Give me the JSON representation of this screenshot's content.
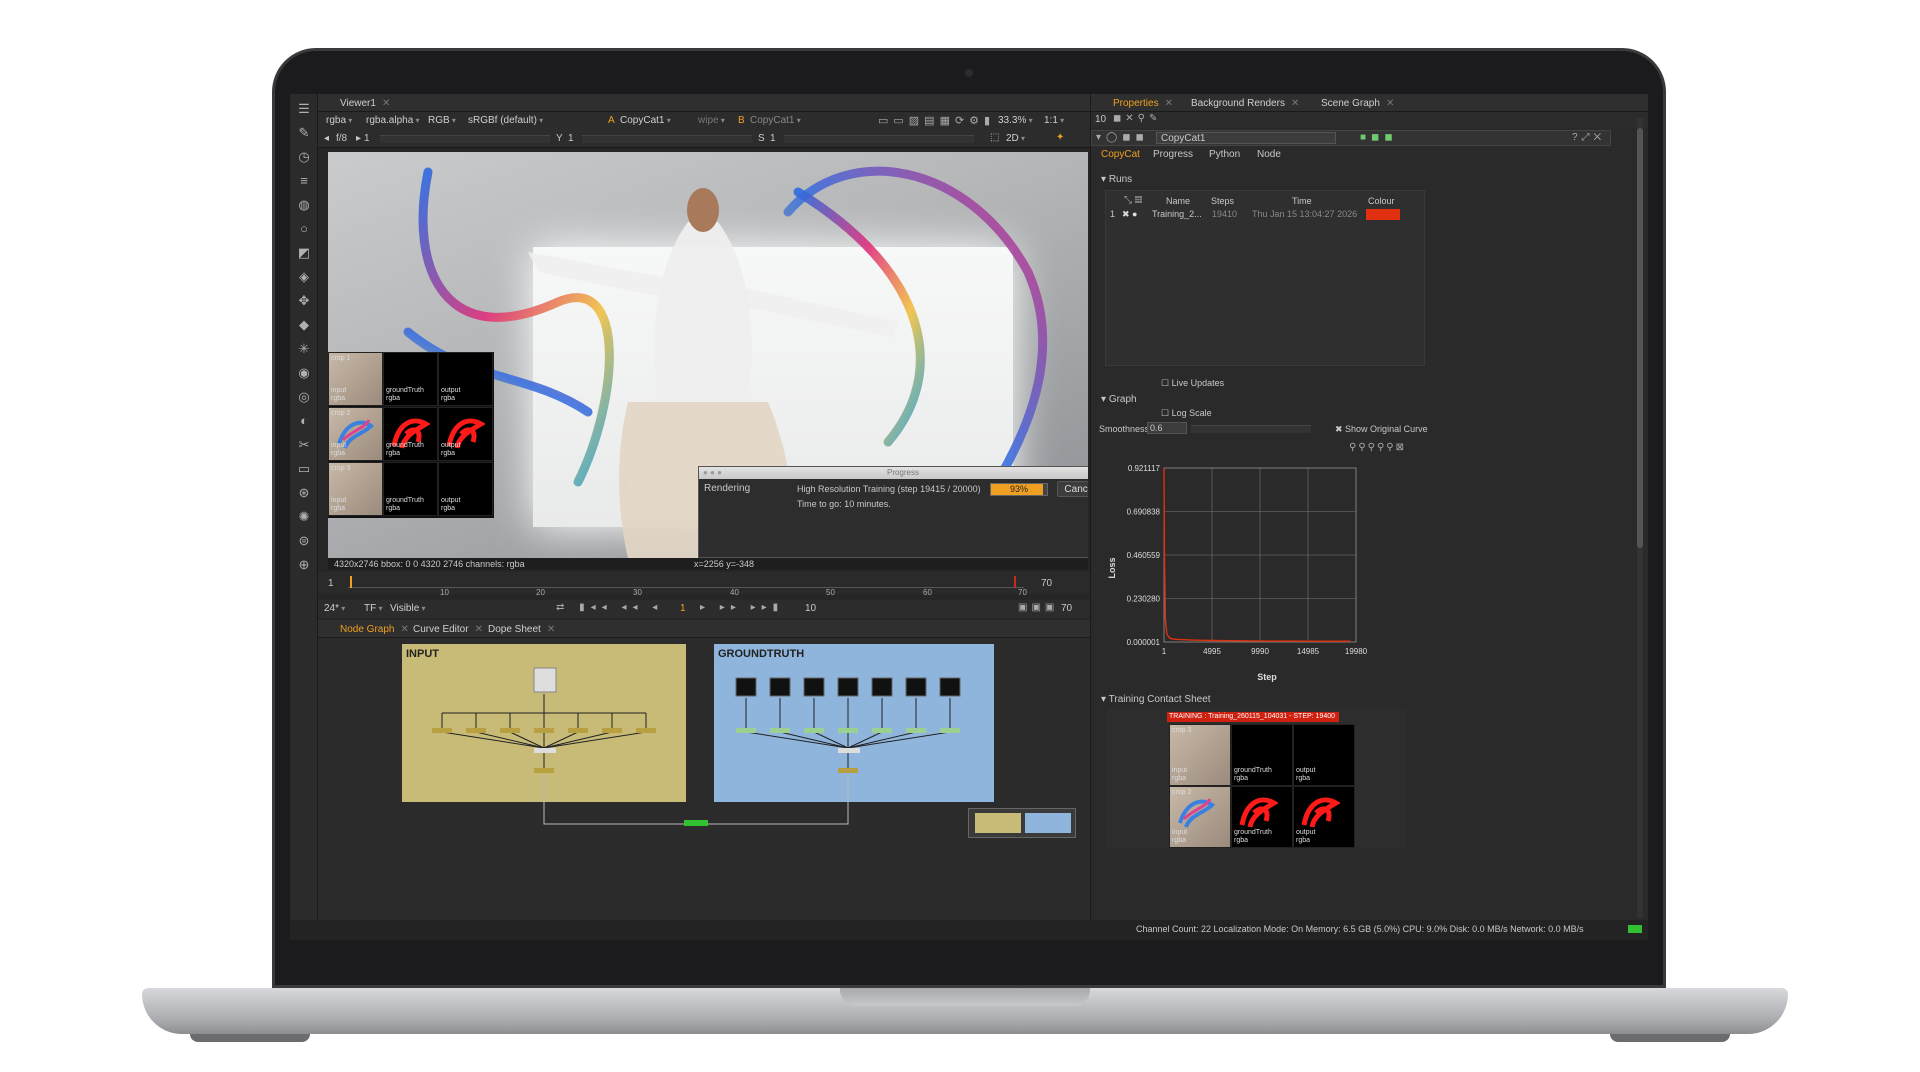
{
  "viewer": {
    "tab_label": "Viewer1",
    "toolbar_row1": {
      "channel": "rgba",
      "alpha": "rgba.alpha",
      "colorspace": "RGB",
      "display": "sRGBf (default)",
      "a_input_prefix": "A",
      "a_input": "CopyCat1",
      "wipe": "wipe",
      "b_input_prefix": "B",
      "b_input": "CopyCat1",
      "zoom": "33.3%",
      "ratio": "1:1"
    },
    "toolbar_row2": {
      "fstop": "f/8",
      "frame_val": "1",
      "y_label": "Y",
      "y_val": "1",
      "s_label": "S",
      "s_val": "1",
      "view_mode": "2D"
    },
    "info_bar": "4320x2746  bbox: 0 0 4320 2746 channels: rgba",
    "coords": "x=2256 y=-348",
    "contact_labels": {
      "crop1": "crop 1",
      "crop2": "crop 2",
      "crop3": "crop 3",
      "input": "input\nrgba",
      "ground": "groundTruth\nrgba",
      "output": "output\nrgba"
    }
  },
  "progress_dialog": {
    "title": "Progress",
    "label": "Rendering",
    "task": "High Resolution Training (step 19415 / 20000)",
    "time": "Time to go: 10 minutes.",
    "percent_label": "93%",
    "percent": 0.93,
    "cancel": "Cancel"
  },
  "timeline": {
    "start_frame": "1",
    "end_frame": "70",
    "tick_labels": [
      "10",
      "20",
      "30",
      "40",
      "50",
      "60",
      "70"
    ],
    "fps": "24*",
    "tf": "TF",
    "visibility": "Visible",
    "current_frame": "1",
    "step_value": "10",
    "end_field": "70"
  },
  "node_graph": {
    "tabs": [
      {
        "label": "Node Graph"
      },
      {
        "label": "Curve Editor"
      },
      {
        "label": "Dope Sheet"
      }
    ],
    "backdrop_input": "INPUT",
    "backdrop_ground": "GROUNDTRUTH"
  },
  "properties": {
    "tabs": [
      {
        "label": "Properties"
      },
      {
        "label": "Background Renders"
      },
      {
        "label": "Scene Graph"
      }
    ],
    "max_panels": "10",
    "node_name": "CopyCat1",
    "node_tabs": [
      {
        "label": "CopyCat"
      },
      {
        "label": "Progress"
      },
      {
        "label": "Python"
      },
      {
        "label": "Node"
      }
    ],
    "runs_section": "Runs",
    "runs_columns": {
      "name": "Name",
      "steps": "Steps",
      "time": "Time",
      "colour": "Colour"
    },
    "run": {
      "index": "1",
      "name": "Training_2...",
      "steps": "19410",
      "time": "Thu Jan 15 13:04:27 2026",
      "colour": "#e03010"
    },
    "live_updates": "Live Updates",
    "graph_section": "Graph",
    "log_scale": "Log Scale",
    "smoothness_label": "Smoothness",
    "smoothness_value": "0.6",
    "show_original": "Show Original Curve",
    "contact_section": "Training Contact Sheet",
    "contact_banner": "TRAINING : Training_260115_104031 - STEP: 19400",
    "contact_labels": {
      "crop3": "crop 3",
      "crop2": "crop 2",
      "input": "input\nrgba",
      "ground": "groundTruth\nrgba",
      "output": "output\nrgba"
    }
  },
  "status_bar": "Channel Count: 22  Localization Mode: On  Memory: 6.5 GB (5.0%)  CPU: 9.0%  Disk: 0.0 MB/s  Network: 0.0 MB/s",
  "colors": {
    "accent_orange": "#f0a020",
    "loss_curve": "#e03010",
    "input_backdrop": "#c8bb78",
    "ground_backdrop": "#8fb5dd",
    "app_bg": "#262626"
  },
  "chart_data": {
    "type": "line",
    "xlabel": "Step",
    "ylabel": "Loss",
    "x_ticks": [
      "1",
      "4995",
      "9990",
      "14985",
      "19980"
    ],
    "y_ticks": [
      "0.921117",
      "0.690838",
      "0.460559",
      "0.230280",
      "0.000001"
    ],
    "xlim": [
      1,
      19980
    ],
    "ylim": [
      1e-06,
      0.921117
    ],
    "grid": true,
    "series": [
      {
        "x": [
          1,
          50,
          150,
          300,
          600,
          1000,
          2000,
          3000,
          4000,
          5000,
          7000,
          9000,
          11000,
          13000,
          15000,
          17000,
          19410
        ],
        "y": [
          0.921117,
          0.45,
          0.12,
          0.04,
          0.02,
          0.015,
          0.012,
          0.01,
          0.009,
          0.008,
          0.007,
          0.006,
          0.005,
          0.005,
          0.004,
          0.004,
          0.004
        ]
      }
    ]
  }
}
